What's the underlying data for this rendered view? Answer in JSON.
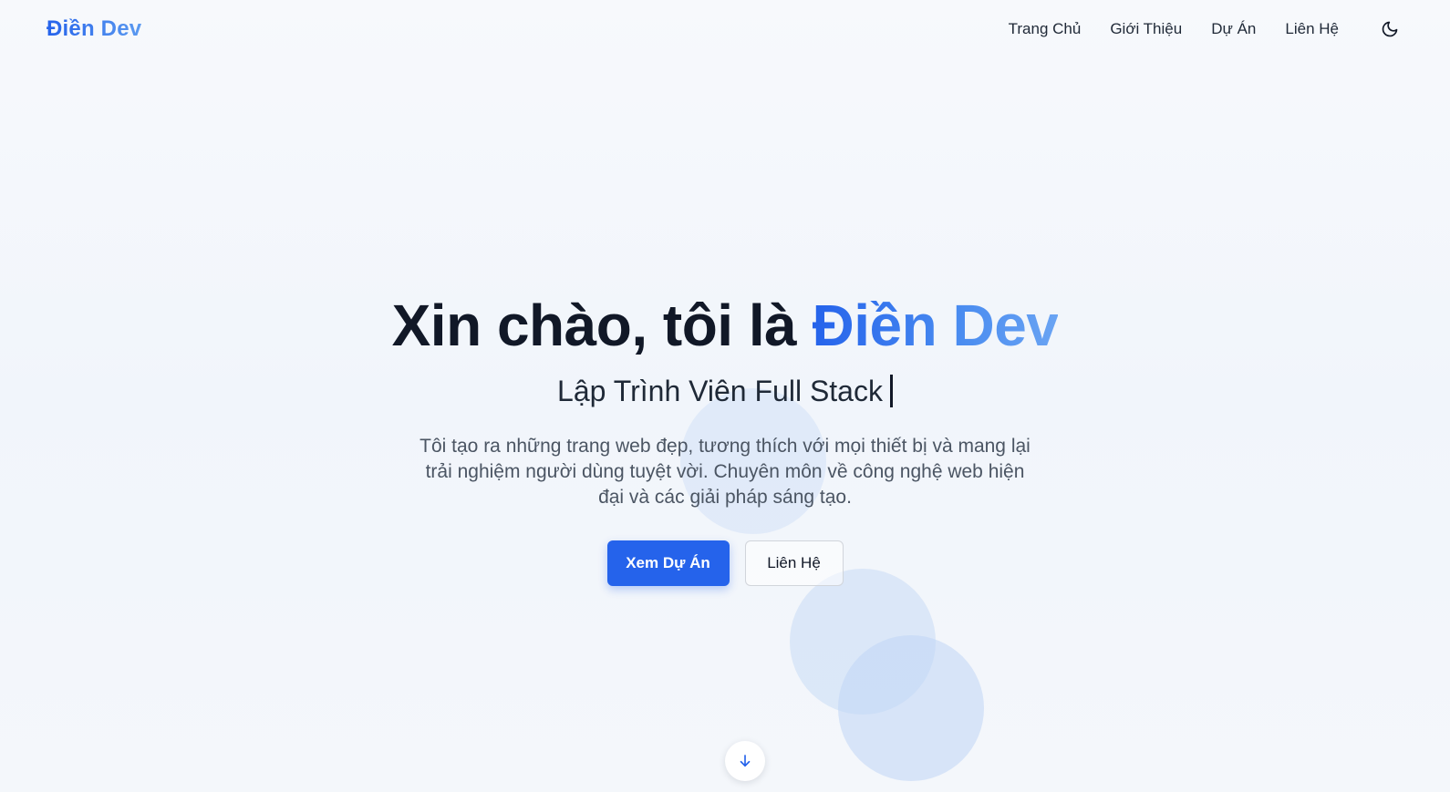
{
  "header": {
    "logo": "Điền Dev",
    "nav": {
      "home": "Trang Chủ",
      "about": "Giới Thiệu",
      "projects": "Dự Án",
      "contact": "Liên Hệ"
    },
    "theme_icon": "moon-icon"
  },
  "hero": {
    "greeting": "Xin chào, tôi là ",
    "name": "Điền Dev",
    "subtitle": "Lập Trình Viên Full Stack",
    "description": "Tôi tạo ra những trang web đẹp, tương thích với mọi thiết bị và mang lại trải nghiệm người dùng tuyệt vời. Chuyên môn về công nghệ web hiện đại và các giải pháp sáng tạo.",
    "primary_button": "Xem Dự Án",
    "secondary_button": "Liên Hệ",
    "scroll_icon": "arrow-down-icon"
  },
  "colors": {
    "accent": "#2563eb",
    "text": "#111827",
    "muted": "#4b5563"
  }
}
